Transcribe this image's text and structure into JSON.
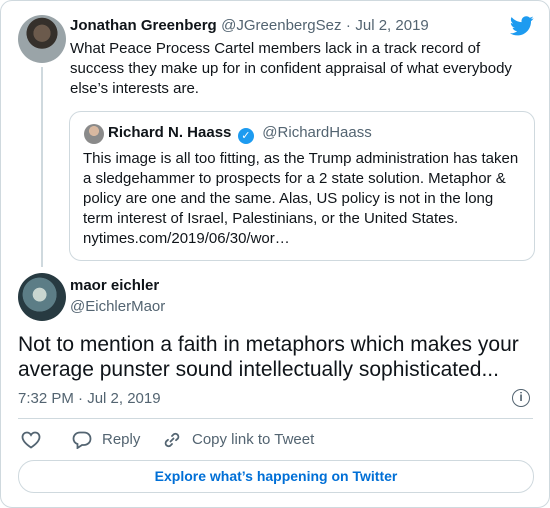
{
  "parent": {
    "name": "Jonathan Greenberg",
    "handle": "@JGreenbergSez",
    "date": "Jul 2, 2019",
    "text": "What Peace Process Cartel members lack in a track record of success they make up for in confident appraisal of what everybody else’s interests are."
  },
  "quoted": {
    "name": "Richard N. Haass",
    "handle": "@RichardHaass",
    "text": "This image is all too fitting, as the Trump administration has taken a sledgehammer to prospects for a 2 state solution. Metaphor & policy are one and the same. Alas, US policy is not in the long term interest of Israel, Palestinians, or the United States. nytimes.com/2019/06/30/wor…"
  },
  "tweet": {
    "name": "maor eichler",
    "handle": "@EichlerMaor",
    "text": "Not to mention a faith in metaphors which makes your average punster sound intellectually sophisticated...",
    "timestamp": "7:32 PM · Jul 2, 2019"
  },
  "actions": {
    "reply": "Reply",
    "copy_link": "Copy link to Tweet"
  },
  "explore_label": "Explore what’s happening on Twitter",
  "icons": {
    "brand": "twitter-bird-icon",
    "verified": "verified-badge-icon",
    "info": "info-icon",
    "like": "heart-icon",
    "reply": "reply-bubble-icon",
    "link": "link-icon"
  },
  "colors": {
    "brand": "#1d9bf0",
    "link": "#006fd6",
    "muted": "#536471",
    "border": "#cfd9de"
  }
}
